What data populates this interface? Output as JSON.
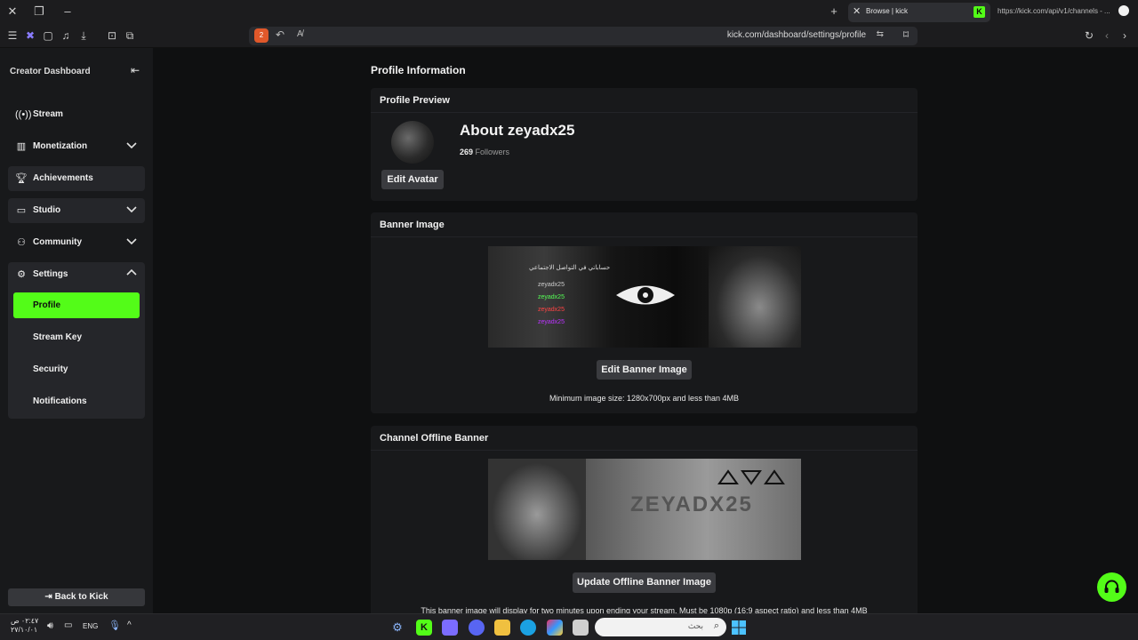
{
  "browser": {
    "active_tab_title": "Browse | kick",
    "second_tab_text": "https://kick.com/api/v1/channels - ...",
    "url": "kick.com/dashboard/settings/profile",
    "shield_count": "2"
  },
  "sidebar": {
    "title": "Creator Dashboard",
    "items": [
      {
        "label": "Stream",
        "icon": "broadcast-icon"
      },
      {
        "label": "Monetization",
        "icon": "chart-icon"
      },
      {
        "label": "Achievements",
        "icon": "trophy-icon"
      },
      {
        "label": "Studio",
        "icon": "studio-icon"
      },
      {
        "label": "Community",
        "icon": "users-icon"
      },
      {
        "label": "Settings",
        "icon": "gear-icon"
      }
    ],
    "settings_sub": [
      {
        "label": "Profile",
        "active": true
      },
      {
        "label": "Stream Key",
        "active": false
      },
      {
        "label": "Security",
        "active": false
      },
      {
        "label": "Notifications",
        "active": false
      }
    ],
    "back_label": "Back to Kick"
  },
  "main": {
    "page_title": "Profile Information",
    "preview": {
      "heading": "Profile Preview",
      "about": "About zeyadx25",
      "followers_count": "269",
      "followers_label": "Followers",
      "edit_avatar": "Edit Avatar"
    },
    "banner": {
      "heading": "Banner Image",
      "edit_button": "Edit Banner Image",
      "note": "Minimum image size: 1280x700px and less than 4MB",
      "overlay_text": "حساباتي في التواصل الاجتماعي",
      "overlay_lines": [
        "zeyadx25",
        "zeyadx25",
        "zeyadx25",
        "zeyadx25"
      ]
    },
    "offline": {
      "heading": "Channel Offline Banner",
      "button": "Update Offline Banner Image",
      "art_text": "ZEYADX25",
      "note": "This banner image will display for two minutes upon ending your stream. Must be 1080p (16:9 aspect ratio) and less than 4MB"
    }
  },
  "taskbar": {
    "search_placeholder": "بحث",
    "time": "٠٢:٤٧ ص",
    "date": "٢٧/١٠/٠١",
    "lang": "ENG"
  },
  "colors": {
    "accent": "#53fc18",
    "background": "#0f1011",
    "card": "#18191b"
  }
}
